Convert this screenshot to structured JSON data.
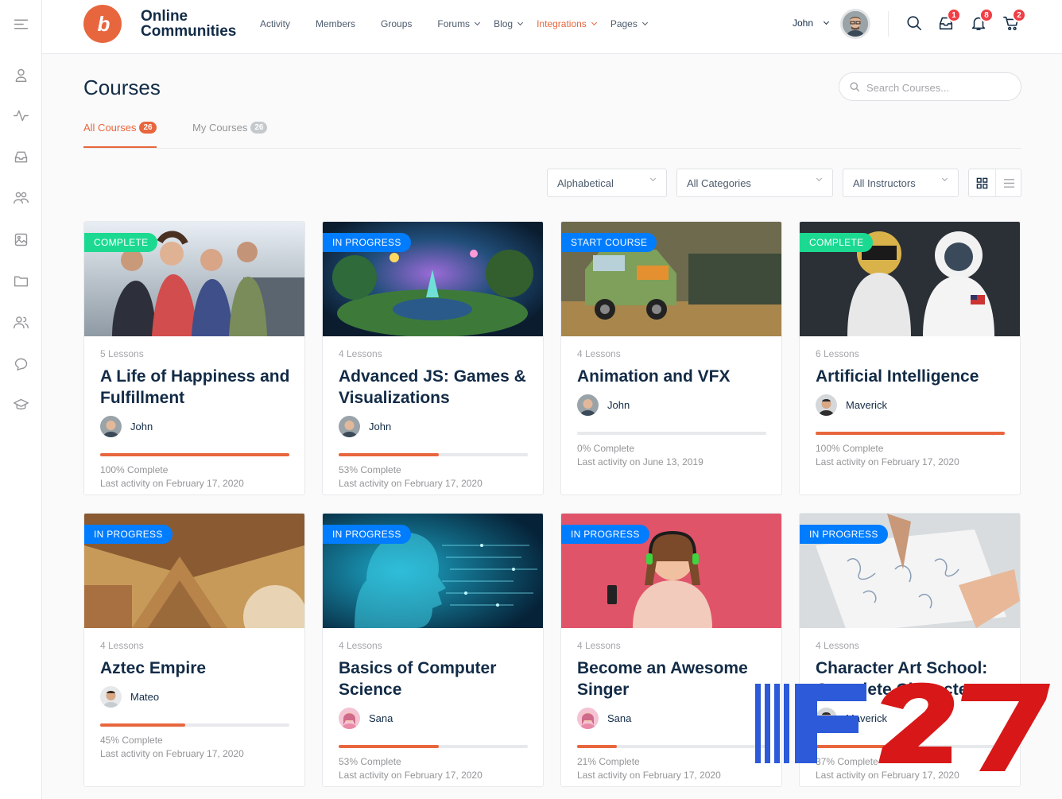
{
  "brand": {
    "line1": "Online",
    "line2": "Communities",
    "mark": "b"
  },
  "nav": [
    {
      "label": "Activity",
      "dropdown": false,
      "active": false
    },
    {
      "label": "Members",
      "dropdown": false,
      "active": false
    },
    {
      "label": "Groups",
      "dropdown": false,
      "active": false
    },
    {
      "label": "Forums",
      "dropdown": true,
      "active": false
    },
    {
      "label": "Blog",
      "dropdown": true,
      "active": false
    },
    {
      "label": "Integrations",
      "dropdown": true,
      "active": true
    },
    {
      "label": "Pages",
      "dropdown": true,
      "active": false
    }
  ],
  "user": {
    "name": "John"
  },
  "header_badges": {
    "messages": "1",
    "notifications": "8",
    "cart": "2"
  },
  "page": {
    "title": "Courses",
    "search_placeholder": "Search Courses..."
  },
  "tabs": [
    {
      "label": "All Courses",
      "count": "26"
    },
    {
      "label": "My Courses",
      "count": "26"
    }
  ],
  "filters": {
    "sort": "Alphabetical",
    "category": "All Categories",
    "instructor": "All Instructors"
  },
  "colors": {
    "accent": "#e8663d",
    "complete": "#1cd991",
    "in_progress": "#007cff",
    "start": "#007cff"
  },
  "courses": [
    {
      "status": "COMPLETE",
      "status_kind": "complete",
      "lessons": "5 Lessons",
      "title": "A Life of Happiness and Fulfillment",
      "author": "John",
      "progress": 100,
      "progress_label": "100% Complete",
      "last_activity": "Last activity on February 17, 2020"
    },
    {
      "status": "IN PROGRESS",
      "status_kind": "in_progress",
      "lessons": "4 Lessons",
      "title": "Advanced JS: Games & Visualizations",
      "author": "John",
      "progress": 53,
      "progress_label": "53% Complete",
      "last_activity": "Last activity on February 17, 2020"
    },
    {
      "status": "START COURSE",
      "status_kind": "start",
      "lessons": "4 Lessons",
      "title": "Animation and VFX",
      "author": "John",
      "progress": 0,
      "progress_label": "0% Complete",
      "last_activity": "Last activity on June 13, 2019"
    },
    {
      "status": "COMPLETE",
      "status_kind": "complete",
      "lessons": "6 Lessons",
      "title": "Artificial Intelligence",
      "author": "Maverick",
      "progress": 100,
      "progress_label": "100% Complete",
      "last_activity": "Last activity on February 17, 2020"
    },
    {
      "status": "IN PROGRESS",
      "status_kind": "in_progress",
      "lessons": "4 Lessons",
      "title": "Aztec Empire",
      "author": "Mateo",
      "progress": 45,
      "progress_label": "45% Complete",
      "last_activity": "Last activity on February 17, 2020"
    },
    {
      "status": "IN PROGRESS",
      "status_kind": "in_progress",
      "lessons": "4 Lessons",
      "title": "Basics of Computer Science",
      "author": "Sana",
      "progress": 53,
      "progress_label": "53% Complete",
      "last_activity": "Last activity on February 17, 2020"
    },
    {
      "status": "IN PROGRESS",
      "status_kind": "in_progress",
      "lessons": "4 Lessons",
      "title": "Become an Awesome Singer",
      "author": "Sana",
      "progress": 21,
      "progress_label": "21% Complete",
      "last_activity": "Last activity on February 17, 2020"
    },
    {
      "status": "IN PROGRESS",
      "status_kind": "in_progress",
      "lessons": "4 Lessons",
      "title": "Character Art School: Complete Character...",
      "author": "Maverick",
      "progress": 37,
      "progress_label": "37% Complete",
      "last_activity": "Last activity on February 17, 2020"
    }
  ],
  "watermark": "F27"
}
